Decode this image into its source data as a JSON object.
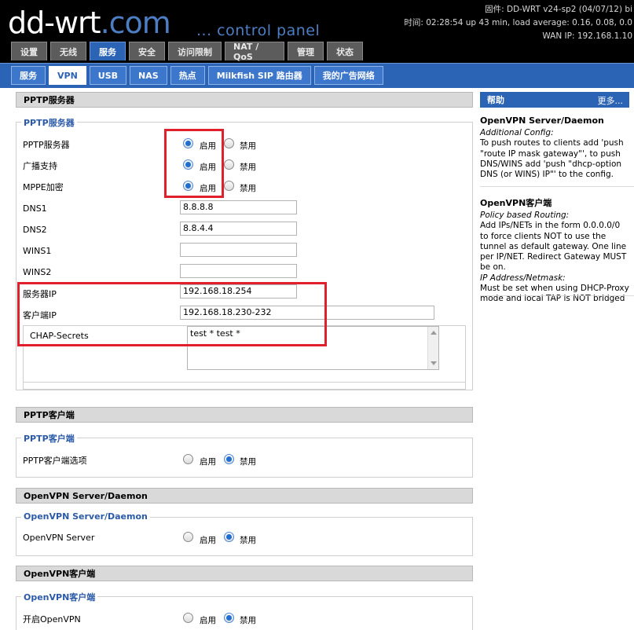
{
  "header": {
    "logo_main": "dd-wrt",
    "logo_suffix": ".com",
    "slogan": "... control panel",
    "firmware": "固件: DD-WRT v24-sp2 (04/07/12) bi",
    "time": "时间: 02:28:54 up 43 min, load average: 0.16, 0.08, 0.0",
    "wan_ip": "WAN IP: 192.168.1.10"
  },
  "main_tabs": [
    "设置",
    "无线",
    "服务",
    "安全",
    "访问限制",
    "NAT / QoS",
    "管理",
    "状态"
  ],
  "active_main_tab": "服务",
  "sub_tabs": [
    "服务",
    "VPN",
    "USB",
    "NAS",
    "热点",
    "Milkfish SIP 路由器",
    "我的广告网络"
  ],
  "active_sub_tab": "VPN",
  "pptp_server": {
    "section_title": "PPTP服务器",
    "legend": "PPTP服务器",
    "enable_label": "启用",
    "disable_label": "禁用",
    "rows": [
      {
        "label": "PPTP服务器",
        "value": "启用"
      },
      {
        "label": "广播支持",
        "value": "启用"
      },
      {
        "label": "MPPE加密",
        "value": "启用"
      }
    ],
    "dns1_label": "DNS1",
    "dns1": "8.8.8.8",
    "dns2_label": "DNS2",
    "dns2": "8.8.4.4",
    "wins1_label": "WINS1",
    "wins1": "",
    "wins2_label": "WINS2",
    "wins2": "",
    "server_ip_label": "服务器IP",
    "server_ip": "192.168.18.254",
    "client_ip_label": "客户端IP",
    "client_ip": "192.168.18.230-232",
    "chap_label": "CHAP-Secrets",
    "chap_value": "test * test *"
  },
  "pptp_client": {
    "section_title": "PPTP客户端",
    "legend": "PPTP客户端",
    "option_label": "PPTP客户端选项",
    "value": "禁用"
  },
  "openvpn_server": {
    "section_title": "OpenVPN Server/Daemon",
    "legend": "OpenVPN Server/Daemon",
    "option_label": "OpenVPN Server",
    "value": "禁用"
  },
  "openvpn_client": {
    "section_title": "OpenVPN客户端",
    "legend": "OpenVPN客户端",
    "option_label": "开启OpenVPN",
    "value": "禁用"
  },
  "help": {
    "title": "帮助",
    "more": "更多...",
    "server_title": "OpenVPN Server/Daemon",
    "server_sub": "Additional Config:",
    "server_text": "To push routes to clients add 'push \"route IP mask gateway\"', to push DNS/WINS add 'push \"dhcp-option DNS (or WINS) IP\"' to the config.",
    "client_title": "OpenVPN客户端",
    "client_sub1": "Policy based Routing:",
    "client_text1": "Add IPs/NETs in the form 0.0.0.0/0 to force clients NOT to use the tunnel as default gateway. One line per IP/NET. Redirect Gateway MUST be on.",
    "client_sub2": "IP Address/Netmask:",
    "client_text2": "Must be set when using DHCP-Proxy mode and local TAP is NOT bridged"
  },
  "colors": {
    "accent_blue": "#2b63b5",
    "highlight_red": "#e0202a"
  }
}
